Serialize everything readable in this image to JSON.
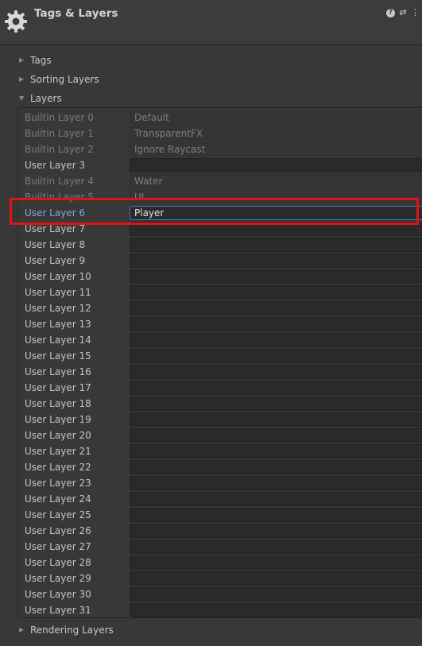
{
  "header": {
    "title": "Tags & Layers",
    "icons": [
      "help-icon",
      "sliders-icon",
      "kebab-menu-icon"
    ]
  },
  "foldouts": {
    "tags": "Tags",
    "sorting_layers": "Sorting Layers",
    "layers": "Layers",
    "rendering_layers": "Rendering Layers"
  },
  "layers": [
    {
      "label": "Builtin Layer 0",
      "value": "Default",
      "builtin": true
    },
    {
      "label": "Builtin Layer 1",
      "value": "TransparentFX",
      "builtin": true
    },
    {
      "label": "Builtin Layer 2",
      "value": "Ignore Raycast",
      "builtin": true
    },
    {
      "label": "User Layer 3",
      "value": "",
      "builtin": false
    },
    {
      "label": "Builtin Layer 4",
      "value": "Water",
      "builtin": true
    },
    {
      "label": "Builtin Layer 5",
      "value": "UI",
      "builtin": true
    },
    {
      "label": "User Layer 6",
      "value": "Player",
      "builtin": false,
      "selected": true
    },
    {
      "label": "User Layer 7",
      "value": "",
      "builtin": false
    },
    {
      "label": "User Layer 8",
      "value": "",
      "builtin": false
    },
    {
      "label": "User Layer 9",
      "value": "",
      "builtin": false
    },
    {
      "label": "User Layer 10",
      "value": "",
      "builtin": false
    },
    {
      "label": "User Layer 11",
      "value": "",
      "builtin": false
    },
    {
      "label": "User Layer 12",
      "value": "",
      "builtin": false
    },
    {
      "label": "User Layer 13",
      "value": "",
      "builtin": false
    },
    {
      "label": "User Layer 14",
      "value": "",
      "builtin": false
    },
    {
      "label": "User Layer 15",
      "value": "",
      "builtin": false
    },
    {
      "label": "User Layer 16",
      "value": "",
      "builtin": false
    },
    {
      "label": "User Layer 17",
      "value": "",
      "builtin": false
    },
    {
      "label": "User Layer 18",
      "value": "",
      "builtin": false
    },
    {
      "label": "User Layer 19",
      "value": "",
      "builtin": false
    },
    {
      "label": "User Layer 20",
      "value": "",
      "builtin": false
    },
    {
      "label": "User Layer 21",
      "value": "",
      "builtin": false
    },
    {
      "label": "User Layer 22",
      "value": "",
      "builtin": false
    },
    {
      "label": "User Layer 23",
      "value": "",
      "builtin": false
    },
    {
      "label": "User Layer 24",
      "value": "",
      "builtin": false
    },
    {
      "label": "User Layer 25",
      "value": "",
      "builtin": false
    },
    {
      "label": "User Layer 26",
      "value": "",
      "builtin": false
    },
    {
      "label": "User Layer 27",
      "value": "",
      "builtin": false
    },
    {
      "label": "User Layer 28",
      "value": "",
      "builtin": false
    },
    {
      "label": "User Layer 29",
      "value": "",
      "builtin": false
    },
    {
      "label": "User Layer 30",
      "value": "",
      "builtin": false
    },
    {
      "label": "User Layer 31",
      "value": "",
      "builtin": false
    }
  ],
  "colors": {
    "background": "#383838",
    "selected_accent": "#3a79bb",
    "highlight_box": "#e01414"
  }
}
